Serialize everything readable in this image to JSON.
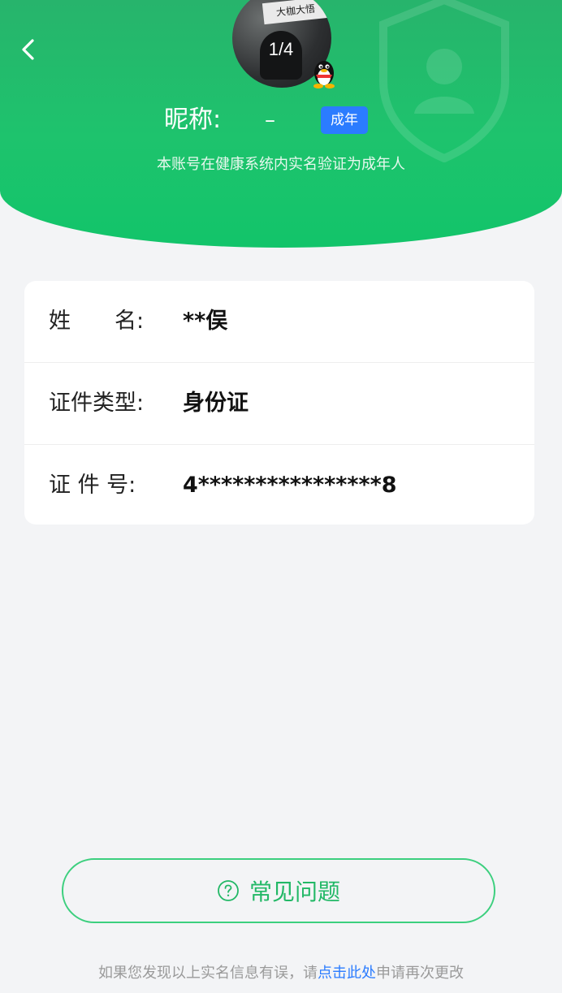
{
  "header": {
    "counter": "1/4",
    "nickname_label": "昵称:",
    "nickname_value": "–",
    "badge": "成年",
    "verify_text": "本账号在健康系统内实名验证为成年人",
    "avatar_sign_text": "大枷大悟"
  },
  "info": {
    "rows": [
      {
        "label": "姓　　名:",
        "value": "**俣"
      },
      {
        "label": "证件类型:",
        "value": "身份证"
      },
      {
        "label": "证 件 号:",
        "value": "4****************8"
      }
    ]
  },
  "faq_button": {
    "label": "常见问题",
    "icon": "question-circle-icon"
  },
  "footer": {
    "prefix": "如果您发现以上实名信息有误，请",
    "link": "点击此处",
    "suffix": "申请再次更改"
  },
  "colors": {
    "header_green": "#1ec36d",
    "badge_blue": "#2b7cff",
    "faq_green": "#22b866",
    "link_blue": "#2b7cff"
  }
}
